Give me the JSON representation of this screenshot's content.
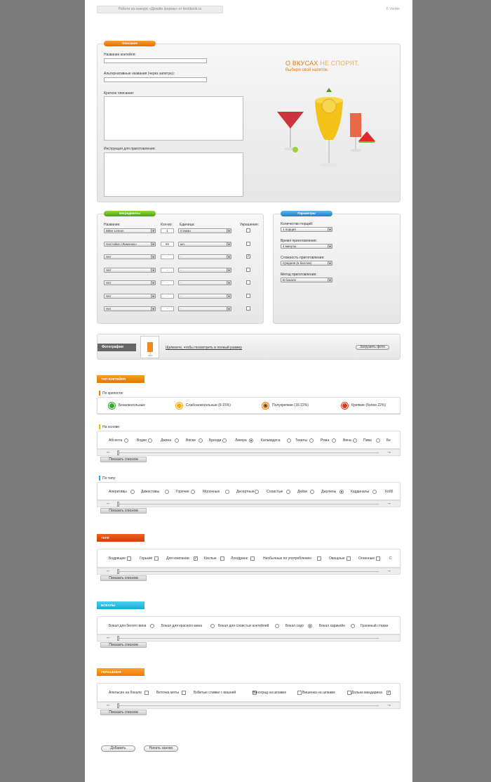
{
  "header": {
    "contest": "Работа на конкурс «Дизайн формы» от ferstbook.ru",
    "copyright": "© Verder"
  },
  "description": {
    "tag": "Описание",
    "name_label": "Название коктейля:",
    "alt_label": "Альтернативные названия (через запятую):",
    "short_label": "Краткое описание:",
    "instr_label": "Инструкция для приготовления:",
    "promo_title_a": "О ВКУСАХ ",
    "promo_title_b": "НЕ СПОРЯТ.",
    "promo_sub": "Выбери свой напиток."
  },
  "ingredients": {
    "tag": "Ингредиенты",
    "col_name": "Название:",
    "col_qty": "Кол-во:",
    "col_unit": "Единица:",
    "col_deco": "Украшение:",
    "rows": [
      {
        "name": "Bitter Lemon",
        "qty": "1",
        "unit": "Стакан",
        "deco": ""
      },
      {
        "name": "Настойка «Лимонка»",
        "qty": "50",
        "unit": "мл.",
        "deco": ""
      },
      {
        "name": "Нет",
        "qty": "-",
        "unit": "-",
        "deco": "✓"
      },
      {
        "name": "Нет",
        "qty": "-",
        "unit": "-",
        "deco": ""
      },
      {
        "name": "Нет",
        "qty": "-",
        "unit": "-",
        "deco": ""
      },
      {
        "name": "Нет",
        "qty": "-",
        "unit": "-",
        "deco": ""
      },
      {
        "name": "Нет",
        "qty": "-",
        "unit": "-",
        "deco": ""
      }
    ]
  },
  "params": {
    "tag": "Параметры",
    "portions_label": "Количество порций:",
    "portions": "1 порция",
    "time_label": "Время приготовления:",
    "time": "4 минуты",
    "difficulty_label": "Сложность приготовления:",
    "difficulty": "Средняя (6 баллов)",
    "method_label": "Метод приготовления:",
    "method": "В бокале"
  },
  "photo": {
    "tag": "Фотография",
    "link": "Щелкните, чтобы посмотреть в полный размер",
    "button": "Загрузить фото"
  },
  "type_section": {
    "flag": "ТИП КОКТЕЙЛЯ",
    "strength_label": "По крепости:",
    "strengths": [
      {
        "label": "Безалкогольные",
        "color": "#3aa535"
      },
      {
        "label": "Слабоалкогольные (6-15%)",
        "color": "#f0b020"
      },
      {
        "label": "Полукрепкие (16-22%)",
        "color": "#e87a10"
      },
      {
        "label": "Крепкие (более 22%)",
        "color": "#d83a20"
      }
    ],
    "base_label": "На основе:",
    "bases": [
      "Абсента",
      "Водки",
      "Джина",
      "Виски",
      "Бренди",
      "Ликера",
      "Кальвадоса",
      "Текилы",
      "Рома",
      "Вина",
      "Пива",
      "Бе"
    ],
    "kind_label": "По типу:",
    "kinds": [
      "Аперитивы",
      "Дижестивы",
      "Горячие",
      "Молочные",
      "Десертные",
      "Слоистые",
      "Дейзи",
      "Джулепы",
      "Кардиналы",
      "Кобб"
    ],
    "list_button": "Показать списком"
  },
  "tags": {
    "flag": "ТЕГИ",
    "items": [
      "Бодрящие",
      "Горькие",
      "Для компании",
      "Кислые",
      "Лонгдринк",
      "Необычные по употреблению",
      "Овощные",
      "Огненные",
      "С"
    ],
    "list_button": "Показать списком"
  },
  "glasses": {
    "flag": "БОКАЛЫ",
    "items": [
      "Бокал для белого вина",
      "Бокал для красного вина",
      "Бокал для слоистых коктейлей",
      "Бокал саур",
      "Бокал харикейн",
      "Граненый стакан"
    ],
    "list_button": "Показать списком"
  },
  "decorations": {
    "flag": "УКРАШЕНИЯ",
    "items": [
      "Апельсин на бокале",
      "Веточка мяты",
      "Взбитые сливки с вишней",
      "Виноград на шпажке",
      "Вишенка на шпажке",
      "Долька мандарина"
    ],
    "list_button": "Показать списком"
  },
  "actions": {
    "add": "Добавить",
    "reset": "Начать заново"
  },
  "colors": {
    "orange": "#e87a00",
    "green": "#5aa817",
    "blue": "#1f8fd6",
    "teal": "#2ab8e0",
    "red": "#e04a10"
  }
}
